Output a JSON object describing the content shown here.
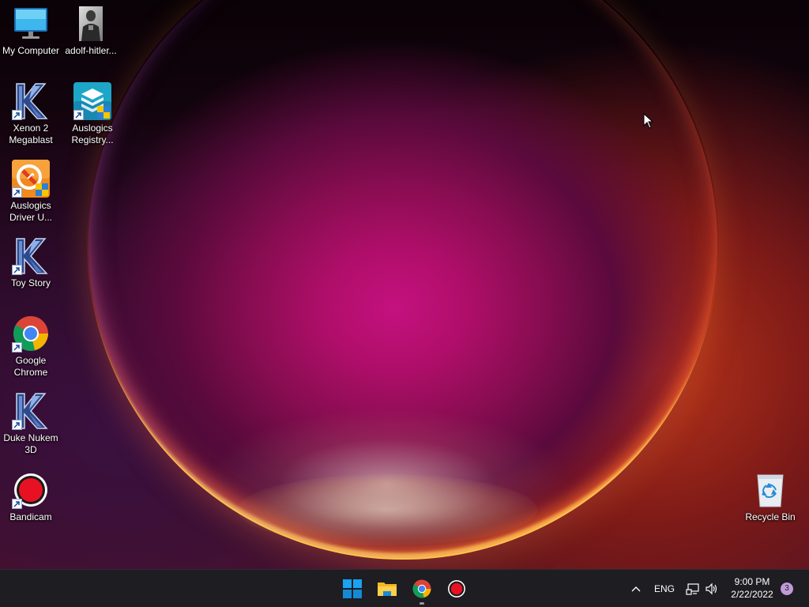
{
  "desktop": {
    "icons": [
      {
        "label": "My Computer",
        "icon": "monitor-icon"
      },
      {
        "label": "adolf-hitler...",
        "icon": "photo-thumbnail-icon"
      },
      {
        "label": "Xenon 2 Megablast",
        "icon": "k-app-icon"
      },
      {
        "label": "Auslogics Registry...",
        "icon": "auslogics-registry-icon"
      },
      {
        "label": "Auslogics Driver U...",
        "icon": "auslogics-driver-icon"
      },
      {
        "label": "Toy Story",
        "icon": "k-app-icon"
      },
      {
        "label": "Google Chrome",
        "icon": "chrome-icon"
      },
      {
        "label": "Duke Nukem 3D",
        "icon": "k-app-icon"
      },
      {
        "label": "Bandicam",
        "icon": "bandicam-icon"
      },
      {
        "label": "Recycle Bin",
        "icon": "recycle-bin-icon"
      }
    ]
  },
  "taskbar": {
    "pinned": [
      {
        "name": "Start",
        "icon": "windows-start-icon"
      },
      {
        "name": "File Explorer",
        "icon": "folder-icon"
      },
      {
        "name": "Google Chrome",
        "icon": "chrome-icon"
      },
      {
        "name": "Bandicam",
        "icon": "bandicam-icon"
      }
    ],
    "tray": {
      "language": "ENG",
      "time": "9:00 PM",
      "date": "2/22/2022",
      "notification_count": "3"
    }
  },
  "colors": {
    "taskbar_bg": "#1d1d22",
    "accent_windows": "#1da1f2",
    "bandicam_red": "#e81123"
  }
}
